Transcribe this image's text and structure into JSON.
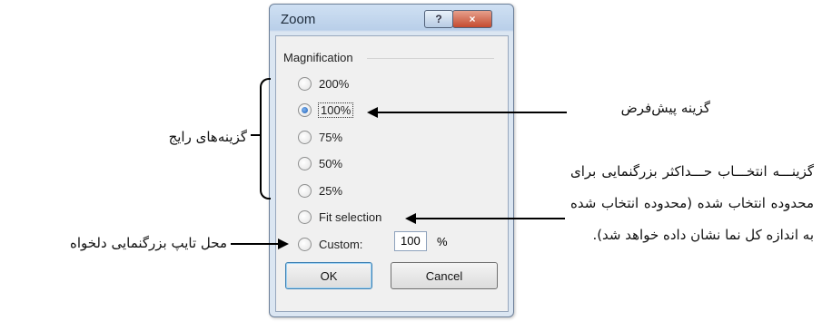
{
  "dialog": {
    "title": "Zoom",
    "help_glyph": "?",
    "close_glyph": "×",
    "group_label": "Magnification",
    "options": [
      {
        "label": "200%",
        "checked": false
      },
      {
        "label": "100%",
        "checked": true
      },
      {
        "label": "75%",
        "checked": false
      },
      {
        "label": "50%",
        "checked": false
      },
      {
        "label": "25%",
        "checked": false
      },
      {
        "label": "Fit selection",
        "checked": false
      },
      {
        "label": "Custom:",
        "checked": false
      }
    ],
    "custom_value": "100",
    "percent_sign": "%",
    "ok_label": "OK",
    "cancel_label": "Cancel"
  },
  "annotations": {
    "common_options": "گزینه‌های رایج",
    "default_option": "گزینه پیش‌فرض",
    "fit_selection_desc": "گزینـــه انتخـــاب حـــداکثر بزرگنمایی برای محدوده انتخاب شده (محدوده انتخاب شده به اندازه کل نما نشان داده خواهد شد).",
    "custom_desc": "محل تایپ بزرگنمایی دلخواه"
  },
  "colors": {
    "title_bar": "#b9cfe9",
    "close_button": "#c44b30",
    "radio_fill": "#1f5fb4"
  }
}
